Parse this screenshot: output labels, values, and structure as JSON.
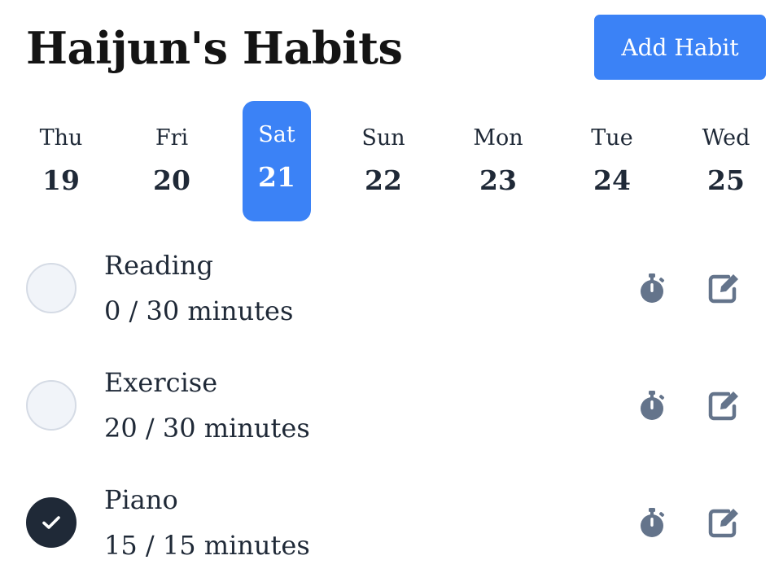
{
  "header": {
    "title": "Haijun's Habits",
    "add_button_label": "Add Habit"
  },
  "days": [
    {
      "dow": "Thu",
      "num": "19",
      "selected": false
    },
    {
      "dow": "Fri",
      "num": "20",
      "selected": false
    },
    {
      "dow": "Sat",
      "num": "21",
      "selected": true
    },
    {
      "dow": "Sun",
      "num": "22",
      "selected": false
    },
    {
      "dow": "Mon",
      "num": "23",
      "selected": false
    },
    {
      "dow": "Tue",
      "num": "24",
      "selected": false
    },
    {
      "dow": "Wed",
      "num": "25",
      "selected": false
    }
  ],
  "habits": [
    {
      "name": "Reading",
      "progress": "0 / 30 minutes",
      "completed": false,
      "timer_icon": "stopwatch-icon",
      "edit_icon": "edit-icon"
    },
    {
      "name": "Exercise",
      "progress": "20 / 30 minutes",
      "completed": false,
      "timer_icon": "stopwatch-icon",
      "edit_icon": "edit-icon"
    },
    {
      "name": "Piano",
      "progress": "15 / 15 minutes",
      "completed": true,
      "timer_icon": "stopwatch-icon",
      "edit_icon": "edit-icon"
    }
  ],
  "colors": {
    "accent": "#3b82f6",
    "text": "#1f2937",
    "icon": "#64748b",
    "circle_empty": "#f1f4f9",
    "circle_done": "#1f2937"
  }
}
